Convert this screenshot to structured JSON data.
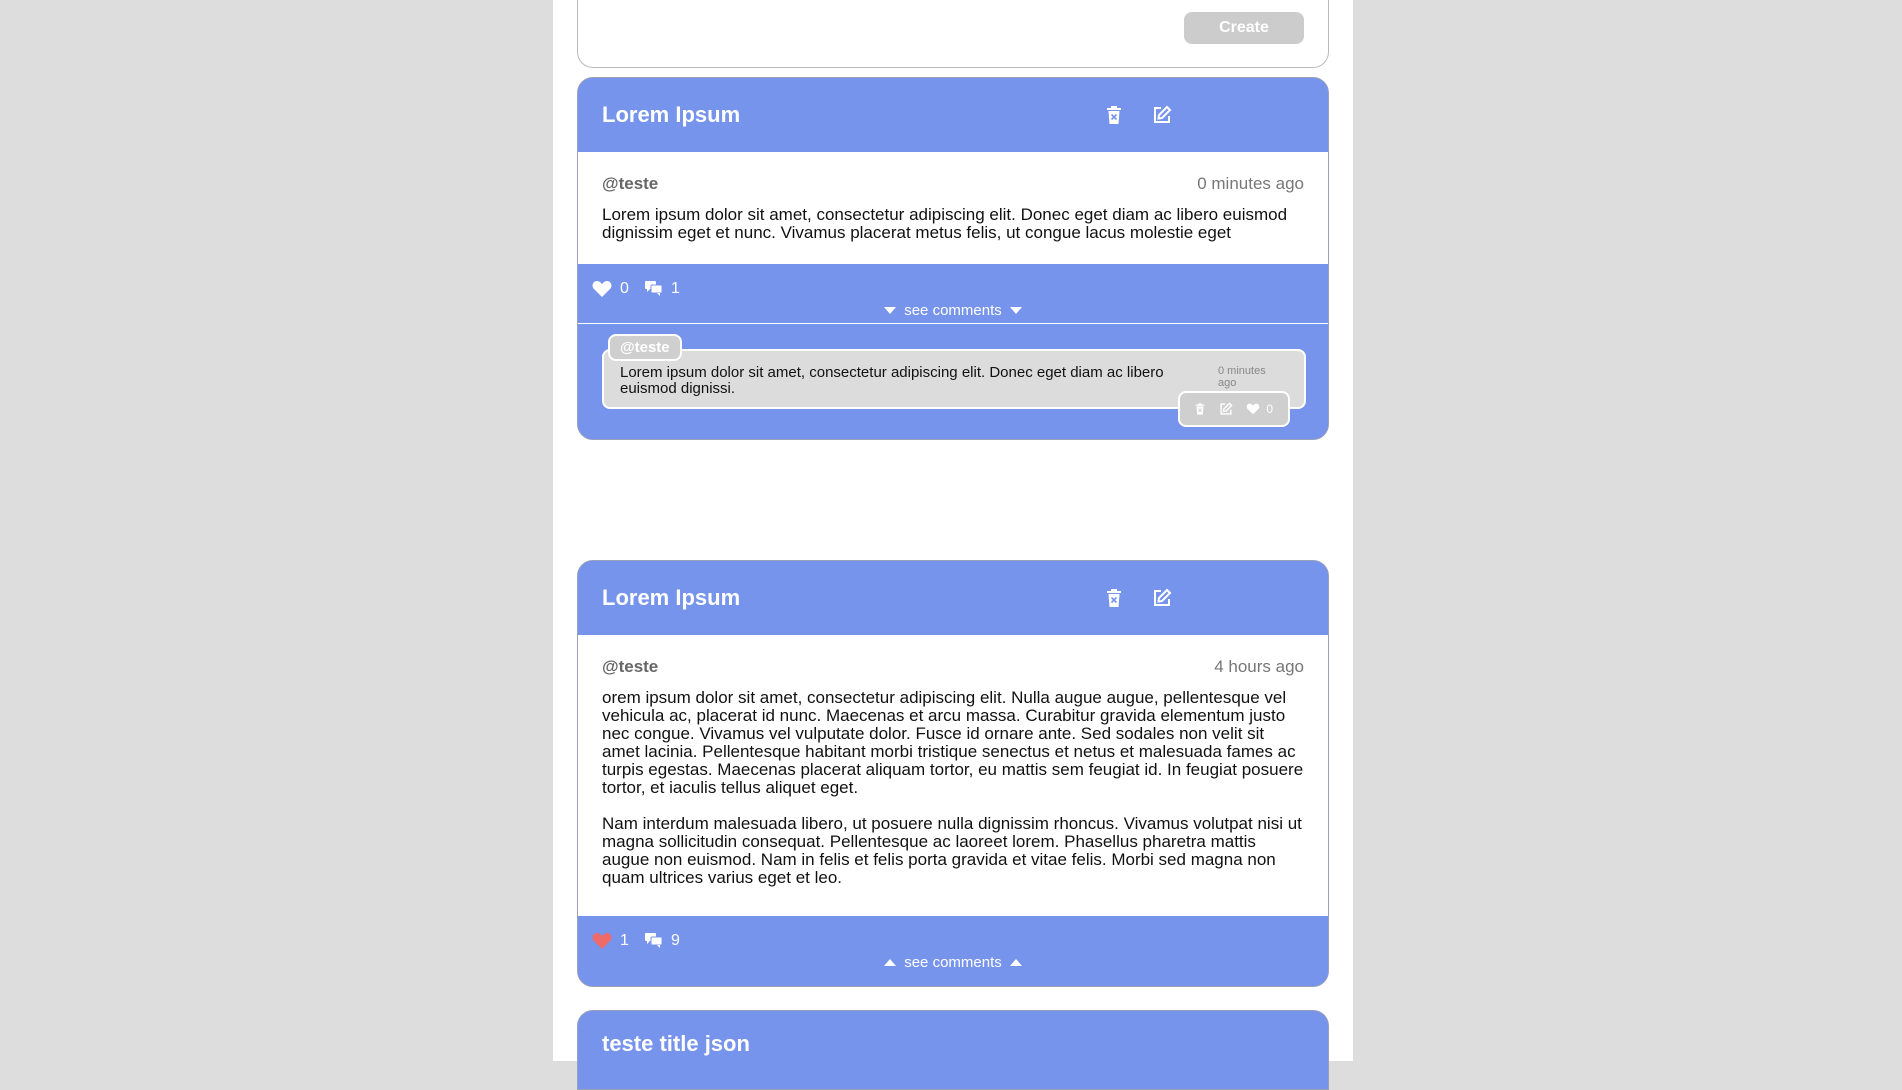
{
  "create": {
    "button_label": "Create"
  },
  "posts": [
    {
      "title": "Lorem Ipsum",
      "author": "@teste",
      "time": "0 minutes ago",
      "paragraphs": [
        "Lorem ipsum dolor sit amet, consectetur adipiscing elit. Donec eget diam ac libero euismod dignissim eget et nunc. Vivamus placerat metus felis, ut congue lacus molestie eget"
      ],
      "likes": "0",
      "liked": false,
      "comments_count": "1",
      "see_comments_label": "see comments",
      "comments_expanded": true,
      "comments": [
        {
          "author": "@teste",
          "text": "Lorem ipsum dolor sit amet, consectetur adipiscing elit. Donec eget diam ac libero euismod dignissi.",
          "time": "0 minutes ago",
          "likes": "0"
        }
      ]
    },
    {
      "title": "Lorem Ipsum",
      "author": "@teste",
      "time": "4 hours ago",
      "paragraphs": [
        "orem ipsum dolor sit amet, consectetur adipiscing elit. Nulla augue augue, pellentesque vel vehicula ac, placerat id nunc. Maecenas et arcu massa. Curabitur gravida elementum justo nec congue. Vivamus vel vulputate dolor. Fusce id ornare ante. Sed sodales non velit sit amet lacinia. Pellentesque habitant morbi tristique senectus et netus et malesuada fames ac turpis egestas. Maecenas placerat aliquam tortor, eu mattis sem feugiat id. In feugiat posuere tortor, et iaculis tellus aliquet eget.",
        "Nam interdum malesuada libero, ut posuere nulla dignissim rhoncus. Vivamus volutpat nisi ut magna sollicitudin consequat. Pellentesque ac laoreet lorem. Phasellus pharetra mattis augue non euismod. Nam in felis et felis porta gravida et vitae felis. Morbi sed magna non quam ultrices varius eget et leo."
      ],
      "likes": "1",
      "liked": true,
      "comments_count": "9",
      "see_comments_label": "see comments",
      "comments_expanded": false
    },
    {
      "title": "teste title json"
    }
  ],
  "colors": {
    "page_bg": "#dddddd",
    "card_accent": "#7794ec",
    "liked_heart": "#ef6b6b",
    "button_disabled": "#cccccc"
  },
  "icons": {
    "delete": "trash-icon",
    "edit": "edit-icon",
    "like": "heart-icon",
    "comments": "comments-icon",
    "expand": "caret-down-icon",
    "collapse": "caret-up-icon"
  }
}
